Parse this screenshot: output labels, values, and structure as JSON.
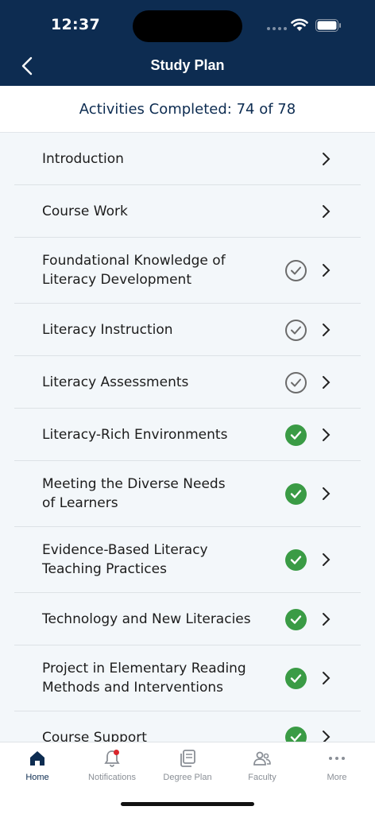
{
  "status": {
    "time": "12:37"
  },
  "header": {
    "title": "Study Plan"
  },
  "summary": {
    "text": "Activities Completed: 74 of 78"
  },
  "list": {
    "items": [
      {
        "label": "Introduction",
        "status": "none"
      },
      {
        "label": "Course Work",
        "status": "none"
      },
      {
        "label": "Foundational Knowledge of Literacy Development",
        "status": "viewed"
      },
      {
        "label": "Literacy Instruction",
        "status": "viewed"
      },
      {
        "label": "Literacy Assessments",
        "status": "viewed"
      },
      {
        "label": "Literacy-Rich Environments",
        "status": "completed"
      },
      {
        "label": "Meeting the Diverse Needs of Learners",
        "status": "completed"
      },
      {
        "label": "Evidence-Based Literacy Teaching Practices",
        "status": "completed"
      },
      {
        "label": "Technology and New Literacies",
        "status": "completed"
      },
      {
        "label": "Project in Elementary Reading Methods and Interventions",
        "status": "completed"
      },
      {
        "label": "Course Support",
        "status": "completed"
      }
    ]
  },
  "tabs": [
    {
      "label": "Home",
      "icon": "home-icon",
      "active": true
    },
    {
      "label": "Notifications",
      "icon": "bell-icon",
      "badge": true
    },
    {
      "label": "Degree Plan",
      "icon": "documents-icon"
    },
    {
      "label": "Faculty",
      "icon": "people-icon"
    },
    {
      "label": "More",
      "icon": "more-icon"
    }
  ],
  "colors": {
    "header": "#0d2c51",
    "completed": "#3a9b45",
    "badge": "#d9262c"
  }
}
